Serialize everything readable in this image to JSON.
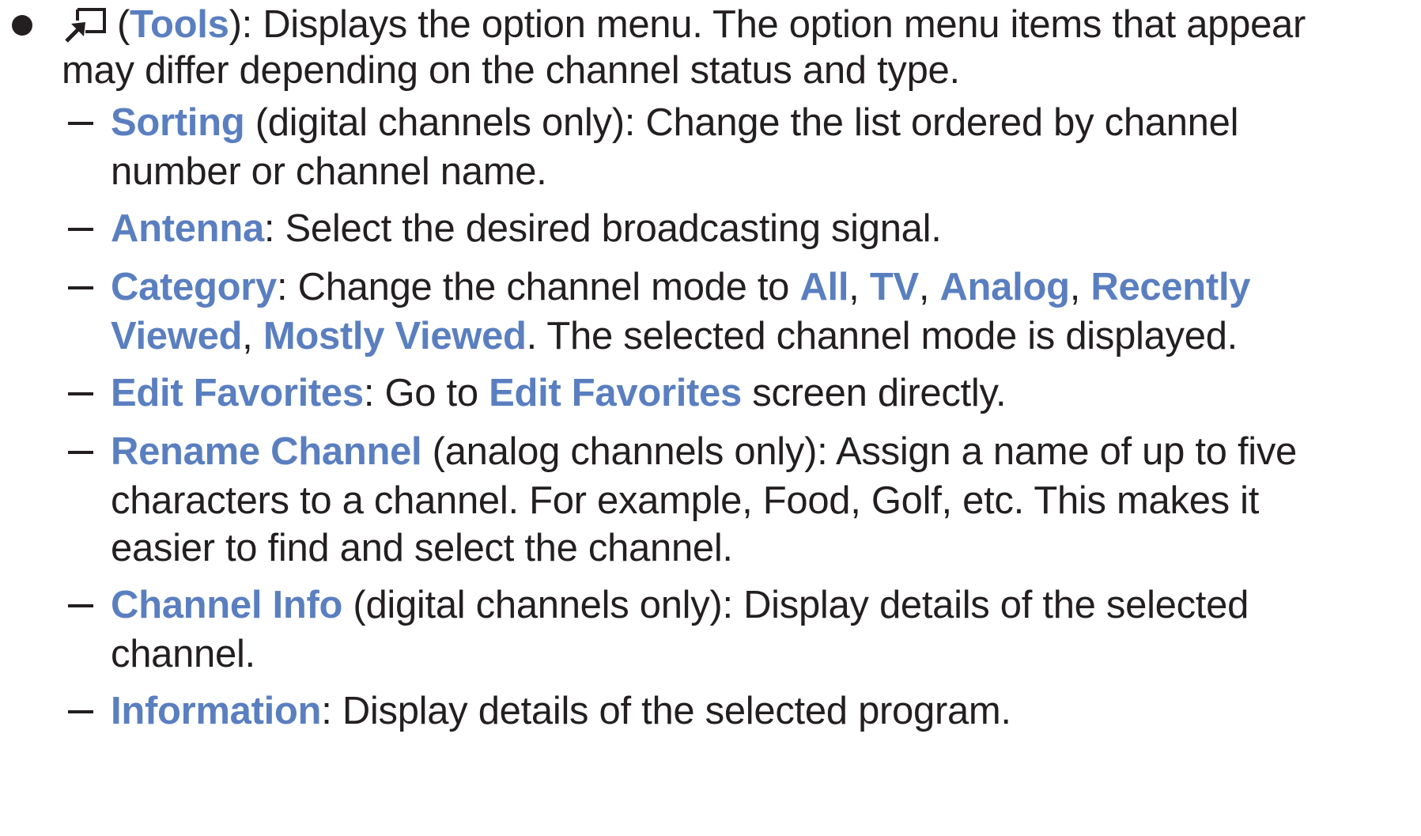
{
  "tools": {
    "icon": "tools-icon",
    "open_paren": "(",
    "label": "Tools",
    "line1_rest": "): Displays the option menu. The option menu items that appear",
    "line2": "may differ depending on the channel status and type."
  },
  "items": [
    {
      "term": "Sorting",
      "line1_rest": " (digital channels only): Change the list ordered by channel",
      "line2": "number or channel name."
    },
    {
      "term": "Antenna",
      "line1_rest": ": Select the desired broadcasting signal."
    },
    {
      "term": "Category",
      "text_a": ": Change the channel mode to ",
      "opt_all": "All",
      "sep1": ", ",
      "opt_tv": "TV",
      "sep2": ", ",
      "opt_analog": "Analog",
      "sep3": ", ",
      "opt_recently_1": "Recently",
      "opt_recently_2": "Viewed",
      "sep4": ", ",
      "opt_mostly": "Mostly Viewed",
      "text_b": ". The selected channel mode is displayed."
    },
    {
      "term": "Edit Favorites",
      "text_a": ": Go to ",
      "term_ref": "Edit Favorites",
      "text_b": " screen directly."
    },
    {
      "term": "Rename Channel",
      "line1_rest": " (analog channels only): Assign a name of up to five",
      "line2": "characters to a channel. For example, Food, Golf, etc. This makes it",
      "line3": "easier to find and select the channel."
    },
    {
      "term": "Channel Info",
      "line1_rest": " (digital channels only): Display details of the selected",
      "line2": "channel."
    },
    {
      "term": "Information",
      "line1_rest": ": Display details of the selected program."
    }
  ]
}
